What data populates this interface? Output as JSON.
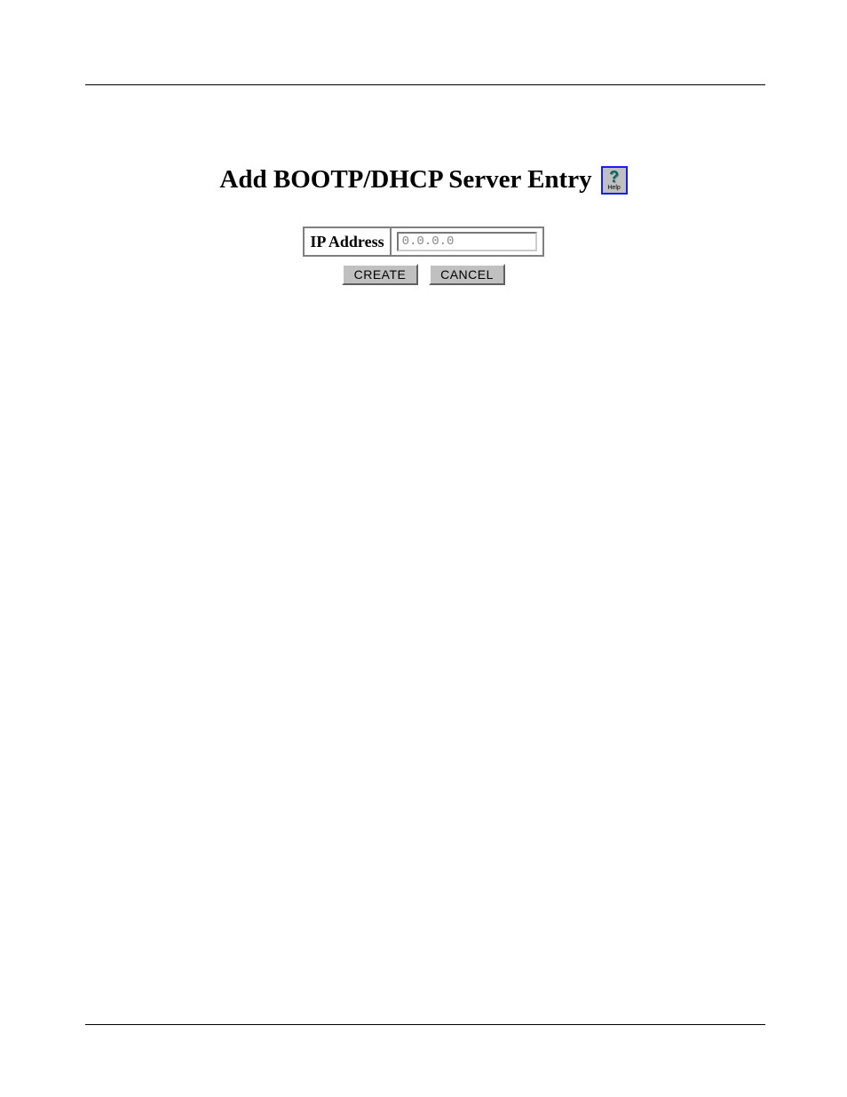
{
  "title": "Add BOOTP/DHCP Server Entry",
  "help": {
    "symbol": "?",
    "label": "Help"
  },
  "form": {
    "ip_label": "IP Address",
    "ip_value": "0.0.0.0"
  },
  "buttons": {
    "create": "CREATE",
    "cancel": "CANCEL"
  }
}
